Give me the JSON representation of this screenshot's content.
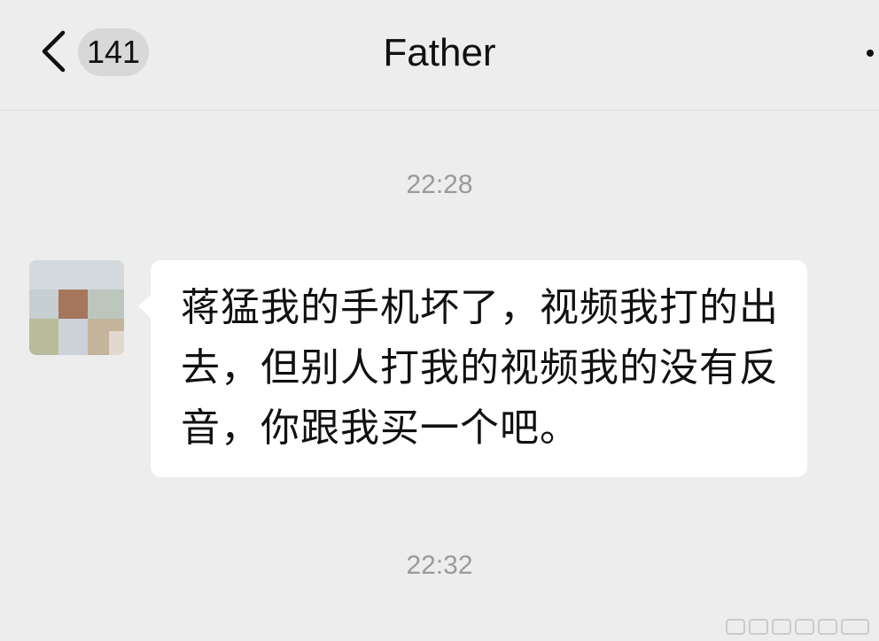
{
  "header": {
    "unread_count": "141",
    "title": "Father",
    "back_icon": "chevron-left-icon",
    "more_icon": "more-dots-icon"
  },
  "chat": {
    "timestamps": [
      "22:28",
      "22:32"
    ],
    "messages": [
      {
        "sender": "Father",
        "side": "left",
        "text": "蒋猛我的手机坏了，视频我打的出去，但别人打我的视频我的没有反音，你跟我买一个吧。"
      }
    ]
  },
  "colors": {
    "background": "#ededed",
    "bubble": "#ffffff",
    "timestamp": "#9a9a9a",
    "badge": "#d8d8d8",
    "text": "#111111"
  }
}
